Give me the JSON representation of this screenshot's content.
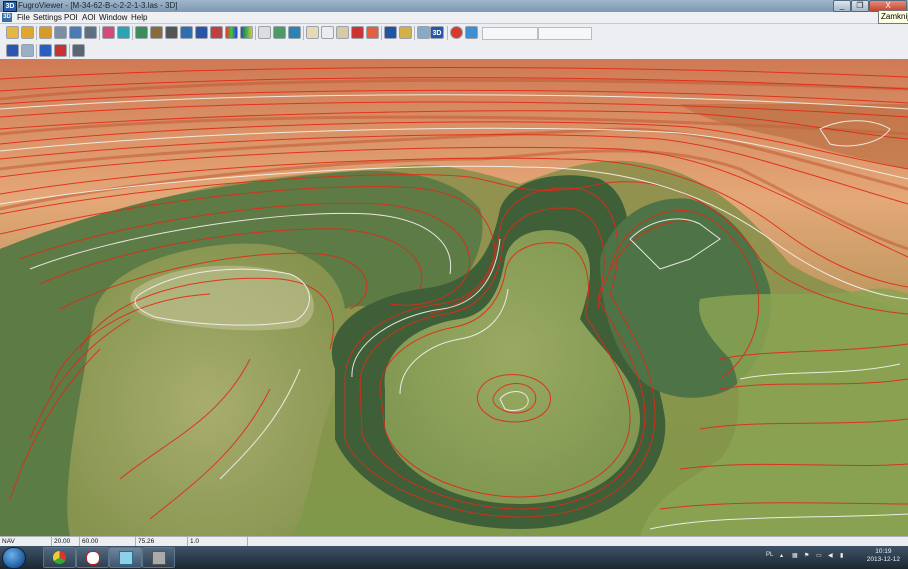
{
  "window": {
    "app_icon_label": "3D",
    "title": "FugroViewer - [M-34-62-B-c-2-2-1-3.las - 3D]",
    "buttons": {
      "minimize": "_",
      "restore": "❐",
      "close": "X"
    },
    "tooltip": "Zamknij"
  },
  "menu": {
    "icon_label": "3D",
    "items": [
      "File",
      "Settings",
      "POI",
      "AOI",
      "Window",
      "Help"
    ]
  },
  "toolbar": {
    "row1_icons": [
      "open-file-icon",
      "open-folder-icon",
      "save-icon",
      "export-icon",
      "profile-icon",
      "grid-icon",
      "select-area-icon",
      "color-fill-icon",
      "layers-icon",
      "surface-icon",
      "points-icon",
      "elevation-color-icon",
      "intensity-color-icon",
      "classification-color-icon",
      "rgb-color-icon",
      "height-color-icon",
      "legend-icon",
      "scatter-points-icon",
      "contours-icon",
      "tin-icon",
      "pan-hand-icon",
      "zoom-icon",
      "measure-icon",
      "poi-marker-icon",
      "target-icon",
      "help-cursor-icon",
      "ruler-icon",
      "pencil-icon",
      "3d-view-icon",
      "stop-icon",
      "refresh-icon"
    ],
    "row2_icons": [
      "home-icon",
      "export-view-icon",
      "download-icon",
      "house-icon",
      "split-view-icon"
    ],
    "view3d_label": "3D"
  },
  "status": {
    "mode": "NAV",
    "field1": "20.00",
    "field2": "60.00",
    "field3": "75.26",
    "field4": "1.0"
  },
  "taskbar": {
    "pinned": [
      "chrome-icon",
      "notification-app-icon",
      "fugroviewer-icon",
      "media-player-icon"
    ],
    "language": "PL",
    "time": "10:19",
    "date": "2013-12-12"
  },
  "colors": {
    "terrain_high": "#d98a60",
    "terrain_mid": "#7f9c4f",
    "terrain_low": "#4d7040",
    "contour_red": "#e02a17",
    "contour_white": "#f4f4f0",
    "ridge_orange": "#c85a33"
  }
}
